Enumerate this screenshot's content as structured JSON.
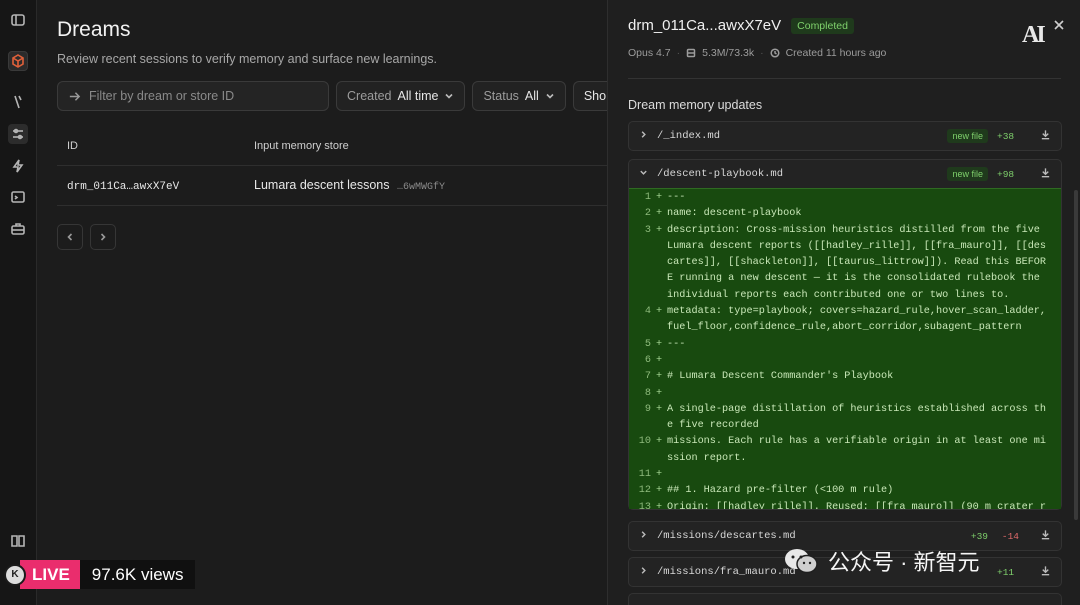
{
  "rail": {
    "icons": [
      "window-icon",
      "brand-icon",
      "wand-icon",
      "dreams-icon",
      "bolt-icon",
      "terminal-icon",
      "toolbox-icon",
      "book-icon"
    ]
  },
  "header": {
    "title": "Dreams",
    "subtitle": "Review recent sessions to verify memory and surface new learnings."
  },
  "filters": {
    "search_placeholder": "Filter by dream or store ID",
    "created_label": "Created",
    "created_value": "All time",
    "status_label": "Status",
    "status_value": "All",
    "store_label_cut": "Sho"
  },
  "table": {
    "columns": [
      "ID",
      "Input memory store"
    ],
    "rows": [
      {
        "id": "drm_011Ca…awxX7eV",
        "store": "Lumara descent lessons",
        "store_id": "…6wMWGfY"
      }
    ]
  },
  "live": {
    "avatar": "K",
    "badge": "LIVE",
    "views": "97.6K views"
  },
  "panel": {
    "title": "drm_011Ca...awxX7eV",
    "status": "Completed",
    "model": "Opus 4.7",
    "tokens": "5.3M/73.3k",
    "created": "Created 11 hours ago",
    "logo": "AI",
    "section_title": "Dream memory updates",
    "files": [
      {
        "name": "/_index.md",
        "tag": "new file",
        "additions": "+38",
        "deletions": ""
      },
      {
        "name": "/descent-playbook.md",
        "tag": "new file",
        "additions": "+98",
        "deletions": ""
      },
      {
        "name": "/missions/descartes.md",
        "tag": "",
        "additions": "+39",
        "deletions": "-14"
      },
      {
        "name": "/missions/fra_mauro.md",
        "tag": "",
        "additions": "+11",
        "deletions": ""
      }
    ],
    "diff_lines": [
      {
        "n": "1",
        "text": "---"
      },
      {
        "n": "2",
        "text": "name: descent-playbook"
      },
      {
        "n": "3",
        "text": "description: Cross-mission heuristics distilled from the five Lumara descent reports ([[hadley_rille]], [[fra_mauro]], [[descartes]], [[shackleton]], [[taurus_littrow]]). Read this BEFORE running a new descent — it is the consolidated rulebook the individual reports each contributed one or two lines to."
      },
      {
        "n": "4",
        "text": "metadata: type=playbook; covers=hazard_rule,hover_scan_ladder,fuel_floor,confidence_rule,abort_corridor,subagent_pattern"
      },
      {
        "n": "5",
        "text": "---"
      },
      {
        "n": "6",
        "text": ""
      },
      {
        "n": "7",
        "text": "# Lumara Descent Commander's Playbook"
      },
      {
        "n": "8",
        "text": ""
      },
      {
        "n": "9",
        "text": "A single-page distillation of heuristics established across the five recorded"
      },
      {
        "n": "10",
        "text": "missions. Each rule has a verifiable origin in at least one mission report."
      },
      {
        "n": "11",
        "text": ""
      },
      {
        "n": "12",
        "text": "## 1. Hazard pre-filter (<100 m rule)"
      },
      {
        "n": "13",
        "text": "Origin: [[hadley_rille]]. Reused: [[fra_mauro]] (90 m crater r"
      }
    ]
  },
  "watermark": {
    "text": "公众号 · 新智元"
  }
}
